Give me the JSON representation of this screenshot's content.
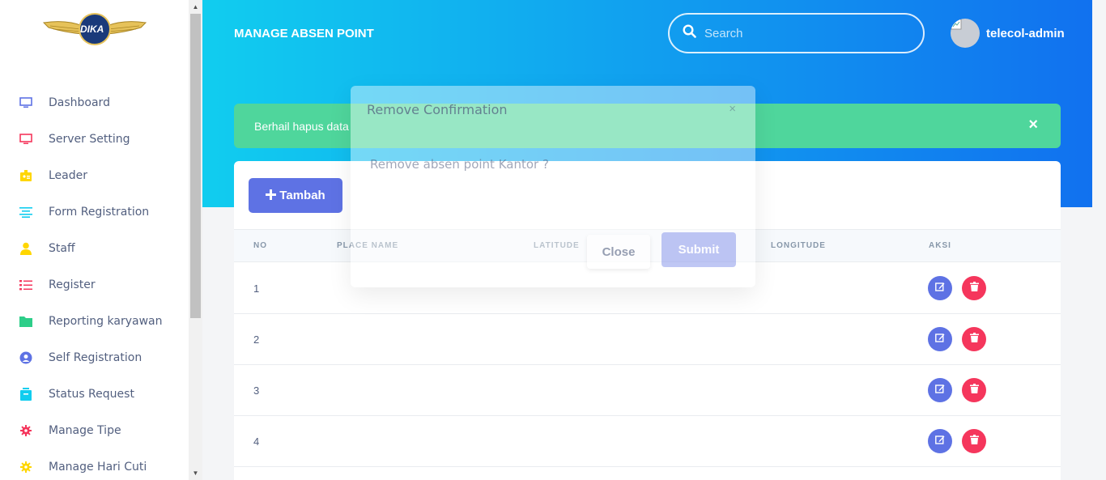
{
  "brand": {
    "logo_text": "DIKA"
  },
  "sidebar": {
    "items": [
      {
        "label": "Dashboard",
        "icon": "monitor-icon",
        "color": "#5e72e4"
      },
      {
        "label": "Server Setting",
        "icon": "monitor-icon",
        "color": "#f5365c"
      },
      {
        "label": "Leader",
        "icon": "badge-icon",
        "color": "#ffd600"
      },
      {
        "label": "Form Registration",
        "icon": "align-center-icon",
        "color": "#11cdef"
      },
      {
        "label": "Staff",
        "icon": "user-icon",
        "color": "#ffd600"
      },
      {
        "label": "Register",
        "icon": "list-icon",
        "color": "#f5365c"
      },
      {
        "label": "Reporting karyawan",
        "icon": "folder-icon",
        "color": "#2dce89"
      },
      {
        "label": "Self Registration",
        "icon": "user-circle-icon",
        "color": "#5e72e4"
      },
      {
        "label": "Status Request",
        "icon": "archive-icon",
        "color": "#11cdef"
      },
      {
        "label": "Manage Tipe",
        "icon": "gear-icon",
        "color": "#f5365c"
      },
      {
        "label": "Manage Hari Cuti",
        "icon": "gear-icon",
        "color": "#ffd600"
      }
    ]
  },
  "header": {
    "title": "MANAGE ABSEN POINT",
    "search_placeholder": "Search",
    "username": "telecol-admin"
  },
  "alert": {
    "message": "Berhail hapus data",
    "close": "×"
  },
  "toolbar": {
    "add_label": "Tambah"
  },
  "table": {
    "columns": [
      "NO",
      "PLACE NAME",
      "LATITUDE",
      "LONGITUDE",
      "AKSI"
    ],
    "rows": [
      {
        "no": "1"
      },
      {
        "no": "2"
      },
      {
        "no": "3"
      },
      {
        "no": "4"
      }
    ]
  },
  "modal": {
    "title": "Remove Confirmation",
    "close_x": "×",
    "body": "Remove absen point Kantor ?",
    "close_label": "Close",
    "submit_label": "Submit"
  },
  "colors": {
    "primary": "#5e72e4",
    "danger": "#f5365c",
    "success": "#4fd69c",
    "header_from": "#11cdef",
    "header_to": "#1171ef"
  }
}
